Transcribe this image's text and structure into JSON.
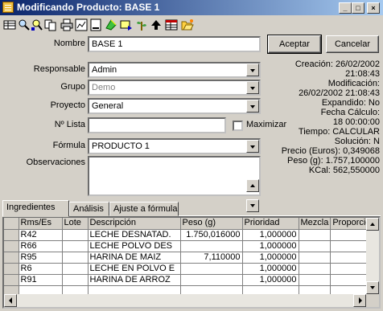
{
  "window": {
    "title": "Modificando Producto: BASE 1",
    "minimize": "_",
    "maximize": "□",
    "close": "×"
  },
  "toolbar": {
    "icons": [
      "grid-icon",
      "search-icon",
      "zoom-search-icon",
      "copy-icon",
      "print-icon",
      "chart-icon",
      "document-icon",
      "check-leaf-icon",
      "arrow-flag-icon",
      "plant-icon",
      "up-arrow-icon",
      "table-icon",
      "folder-open-icon"
    ]
  },
  "form": {
    "nombre_label": "Nombre",
    "nombre_value": "BASE 1",
    "responsable_label": "Responsable",
    "responsable_value": "Admin",
    "grupo_label": "Grupo",
    "grupo_value": "Demo",
    "proyecto_label": "Proyecto",
    "proyecto_value": "General",
    "nlista_label": "Nº Lista",
    "nlista_value": "",
    "maximizar_label": "Maximizar",
    "formula_label": "Fórmula",
    "formula_value": "PRODUCTO 1",
    "observaciones_label": "Observaciones",
    "observaciones_value": ""
  },
  "buttons": {
    "aceptar": "Aceptar",
    "cancelar": "Cancelar"
  },
  "info": {
    "line1": "Creación: 26/02/2002",
    "line2": "21:08:43",
    "line3": "Modificación:",
    "line4": "26/02/2002 21:08:43",
    "line5": "Expandido: No",
    "line6": "Fecha Cálculo:",
    "line7": "18 00:00:00",
    "line8": "Tiempo: CALCULAR",
    "line9": "Solución: N",
    "line10": "Precio (Euros): 0,349068",
    "line11": "Peso (g): 1.757,100000",
    "line12": "KCal: 562,550000"
  },
  "tabs": [
    {
      "label": "Ingredientes"
    },
    {
      "label": "Análisis"
    },
    {
      "label": "Ajuste a fórmula"
    }
  ],
  "grid": {
    "columns": [
      "",
      "Rms/Es",
      "Lote",
      "Descripción",
      "Peso (g)",
      "Prioridad",
      "Mezcla",
      "Proporció"
    ],
    "rows": [
      {
        "code": "R42",
        "lote": "",
        "desc": "LECHE DESNATAD.",
        "peso": "1.750,016000",
        "prioridad": "1,000000",
        "mezcla": "",
        "proporcion": ""
      },
      {
        "code": "R66",
        "lote": "",
        "desc": "LECHE POLVO DES",
        "peso": "",
        "prioridad": "1,000000",
        "mezcla": "",
        "proporcion": ""
      },
      {
        "code": "R95",
        "lote": "",
        "desc": "HARINA DE MAIZ",
        "peso": "7,110000",
        "prioridad": "1,000000",
        "mezcla": "",
        "proporcion": ""
      },
      {
        "code": "R6",
        "lote": "",
        "desc": "LECHE EN POLVO E",
        "peso": "",
        "prioridad": "1,000000",
        "mezcla": "",
        "proporcion": ""
      },
      {
        "code": "R91",
        "lote": "",
        "desc": "HARINA DE ARROZ",
        "peso": "",
        "prioridad": "1,000000",
        "mezcla": "",
        "proporcion": ""
      }
    ]
  }
}
